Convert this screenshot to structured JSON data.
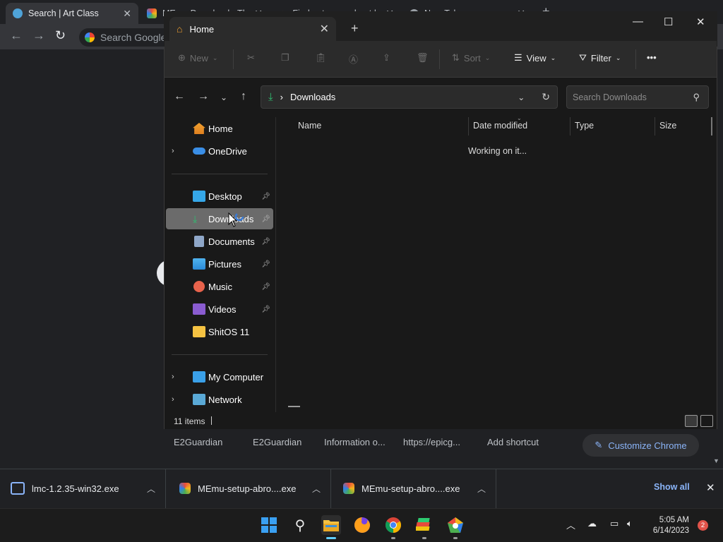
{
  "chrome": {
    "tabs": [
      {
        "title": "Search | Art Class",
        "close": "✕"
      },
      {
        "title": "MEmu Download - Th",
        "close": "✕"
      },
      {
        "title": "Find out more about |",
        "close": "✕"
      },
      {
        "title": "New Tab",
        "close": "✕"
      }
    ],
    "new_tab": "+",
    "omnibox_placeholder": "Search Google",
    "shortcuts": [
      "E2Guardian",
      "E2Guardian",
      "Information o...",
      "https://epicg...",
      "Add shortcut"
    ],
    "customize_label": "Customize Chrome",
    "accent_color": "#8ab4f8"
  },
  "downloads": {
    "items": [
      {
        "name": "lmc-1.2.35-win32.exe"
      },
      {
        "name": "MEmu-setup-abro....exe"
      },
      {
        "name": "MEmu-setup-abro....exe"
      }
    ],
    "show_all": "Show all",
    "close": "✕"
  },
  "explorer": {
    "tab_title": "Home",
    "tab_close": "✕",
    "new_tab": "+",
    "window_controls": {
      "minimize": "—",
      "maximize": "☐",
      "close": "✕"
    },
    "command_bar": {
      "new": "New",
      "sort": "Sort",
      "view": "View",
      "filter": "Filter",
      "more": "•••"
    },
    "address": {
      "location": "Downloads",
      "separator": "›"
    },
    "search_placeholder": "Search Downloads",
    "sidebar": [
      {
        "label": "Home",
        "expandable": false,
        "pinned": false,
        "icon": "home-icon"
      },
      {
        "label": "OneDrive",
        "expandable": true,
        "pinned": false,
        "icon": "cloud-icon"
      },
      {
        "label": "Desktop",
        "expandable": false,
        "pinned": true,
        "icon": "desktop-icon"
      },
      {
        "label": "Downloads",
        "expandable": false,
        "pinned": true,
        "icon": "download-icon",
        "selected": true
      },
      {
        "label": "Documents",
        "expandable": false,
        "pinned": true,
        "icon": "document-icon"
      },
      {
        "label": "Pictures",
        "expandable": false,
        "pinned": true,
        "icon": "pictures-icon"
      },
      {
        "label": "Music",
        "expandable": false,
        "pinned": true,
        "icon": "music-icon"
      },
      {
        "label": "Videos",
        "expandable": false,
        "pinned": true,
        "icon": "videos-icon"
      },
      {
        "label": "ShitOS 11",
        "expandable": false,
        "pinned": false,
        "icon": "folder-icon"
      },
      {
        "label": "My Computer",
        "expandable": true,
        "pinned": false,
        "icon": "computer-icon"
      },
      {
        "label": "Network",
        "expandable": true,
        "pinned": false,
        "icon": "network-icon"
      }
    ],
    "columns": [
      "Name",
      "Date modified",
      "Type",
      "Size"
    ],
    "loading_text": "Working on it...",
    "status": "11 items"
  },
  "taskbar": {
    "clock_time": "5:05 AM",
    "clock_date": "6/14/2023",
    "notification_count": "2"
  }
}
